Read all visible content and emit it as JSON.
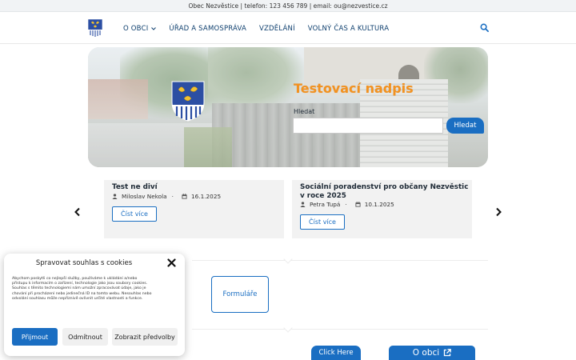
{
  "topbar": {
    "text": "Obec Nezvěstice | telefon: 123 456 789 | email: ou@nezvestice.cz"
  },
  "nav": {
    "items": [
      {
        "label": "O OBCI",
        "has_dropdown": true
      },
      {
        "label": "ÚŘAD A SAMOSPRÁVA"
      },
      {
        "label": "VZDĚLÁNÍ"
      },
      {
        "label": "VOLNÝ ČAS A KULTURA"
      }
    ],
    "search_icon": "search-icon"
  },
  "hero": {
    "title": "Testovací nadpis",
    "search_label": "Hledat",
    "search_value": "",
    "search_button": "Hledat"
  },
  "news": [
    {
      "title": "Test ne diví",
      "author": "Miloslav Nekola",
      "date": "16.1.2025",
      "button": "Číst více"
    },
    {
      "title": "Sociální poradenství pro občany Nezvěstic v roce 2025",
      "author": "Petra Tupá",
      "date": "10.1.2025",
      "button": "Číst více"
    }
  ],
  "tiles": {
    "forms": "Formuláře"
  },
  "bottom": {
    "click_here": "Click Here",
    "obci": "O obci"
  },
  "cookie": {
    "title": "Spravovat souhlas s cookies",
    "text": "Abychom poskytli co nejlepší služby, používáme k ukládání a/nebo přístupu k informacím o zařízení, technologie jako jsou soubory cookies. Souhlas s těmito technologiemi nám umožní zpracovávat údaje, jako je chování při procházení nebo jedinečná ID na tomto webu. Nesouhlas nebo odvolání souhlasu může nepříznivě ovlivnit určité vlastnosti a funkce.",
    "accept": "Přijmout",
    "deny": "Odmítnout",
    "prefs": "Zobrazit předvolby"
  },
  "colors": {
    "primary": "#1a6ec2",
    "nav_text": "#0e3f6e",
    "hero_title": "#f39220"
  }
}
